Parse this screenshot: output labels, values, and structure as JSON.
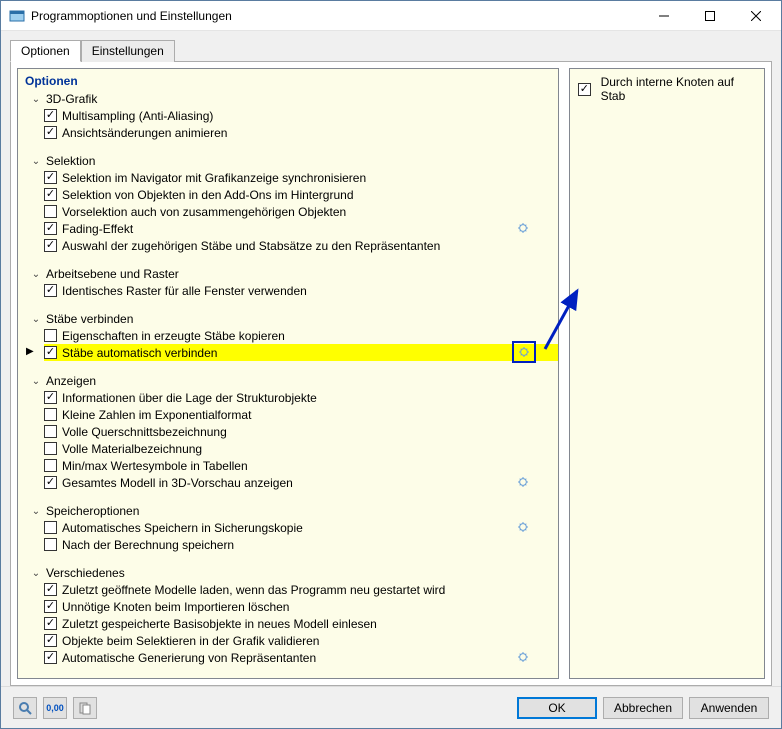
{
  "window": {
    "title": "Programmoptionen und Einstellungen"
  },
  "tabs": {
    "optionen": "Optionen",
    "einstellungen": "Einstellungen"
  },
  "tree": {
    "header": "Optionen",
    "groups": [
      {
        "title": "3D-Grafik",
        "items": [
          {
            "label": "Multisampling (Anti-Aliasing)",
            "checked": true
          },
          {
            "label": "Ansichtsänderungen animieren",
            "checked": true
          }
        ]
      },
      {
        "title": "Selektion",
        "items": [
          {
            "label": "Selektion im Navigator mit Grafikanzeige synchronisieren",
            "checked": true
          },
          {
            "label": "Selektion von Objekten in den Add-Ons im Hintergrund",
            "checked": true
          },
          {
            "label": "Vorselektion auch von zusammengehörigen Objekten",
            "checked": false
          },
          {
            "label": "Fading-Effekt",
            "checked": true,
            "gear": true
          },
          {
            "label": "Auswahl der zugehörigen Stäbe und Stabsätze zu den Repräsentanten",
            "checked": true
          }
        ]
      },
      {
        "title": "Arbeitsebene und Raster",
        "items": [
          {
            "label": "Identisches Raster für alle Fenster verwenden",
            "checked": true
          }
        ]
      },
      {
        "title": "Stäbe verbinden",
        "items": [
          {
            "label": "Eigenschaften in erzeugte Stäbe kopieren",
            "checked": false
          },
          {
            "label": "Stäbe automatisch verbinden",
            "checked": true,
            "gear": true,
            "highlight": true,
            "boxed": true,
            "indicator": true
          }
        ]
      },
      {
        "title": "Anzeigen",
        "items": [
          {
            "label": "Informationen über die Lage der Strukturobjekte",
            "checked": true
          },
          {
            "label": "Kleine Zahlen im Exponentialformat",
            "checked": false
          },
          {
            "label": "Volle Querschnittsbezeichnung",
            "checked": false
          },
          {
            "label": "Volle Materialbezeichnung",
            "checked": false
          },
          {
            "label": "Min/max Wertesymbole in Tabellen",
            "checked": false
          },
          {
            "label": "Gesamtes Modell in 3D-Vorschau anzeigen",
            "checked": true,
            "gear": true
          }
        ]
      },
      {
        "title": "Speicheroptionen",
        "items": [
          {
            "label": "Automatisches Speichern in Sicherungskopie",
            "checked": false,
            "gear": true
          },
          {
            "label": "Nach der Berechnung speichern",
            "checked": false
          }
        ]
      },
      {
        "title": "Verschiedenes",
        "items": [
          {
            "label": "Zuletzt geöffnete Modelle laden, wenn das Programm neu gestartet wird",
            "checked": true
          },
          {
            "label": "Unnötige Knoten beim Importieren löschen",
            "checked": true
          },
          {
            "label": "Zuletzt gespeicherte Basisobjekte in neues Modell einlesen",
            "checked": true
          },
          {
            "label": "Objekte beim Selektieren in der Grafik validieren",
            "checked": true
          },
          {
            "label": "Automatische Generierung von Repräsentanten",
            "checked": true,
            "gear": true
          }
        ]
      }
    ]
  },
  "detail": {
    "item1": {
      "label": "Durch interne Knoten auf Stab",
      "checked": true
    }
  },
  "buttons": {
    "ok": "OK",
    "cancel": "Abbrechen",
    "apply": "Anwenden"
  },
  "footer_icons": {
    "a": "0,00"
  }
}
